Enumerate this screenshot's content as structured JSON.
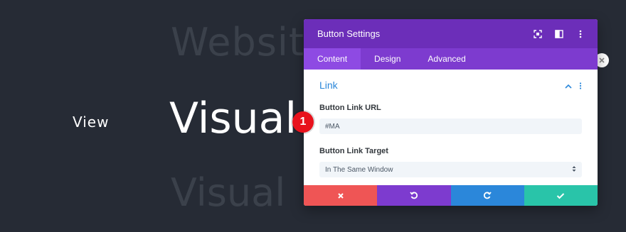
{
  "background": {
    "website_text": "Websit",
    "view_text": "View",
    "visual_text": "Visual",
    "visual2_text": "Visual"
  },
  "marker": {
    "number": "1"
  },
  "modal": {
    "title": "Button Settings",
    "tabs": [
      {
        "label": "Content",
        "active": true
      },
      {
        "label": "Design",
        "active": false
      },
      {
        "label": "Advanced",
        "active": false
      }
    ],
    "section": {
      "title": "Link",
      "fields": [
        {
          "label": "Button Link URL",
          "value": "#MA"
        },
        {
          "label": "Button Link Target",
          "value": "In The Same Window"
        }
      ]
    }
  },
  "colors": {
    "header": "#6c2eb9",
    "tabs": "#7d3bcf",
    "cancel": "#ef5555",
    "undo": "#7d3bcf",
    "redo": "#2b87da",
    "save": "#29c4a9",
    "accent": "#2b87da"
  },
  "icons": {
    "header": [
      "expand-icon",
      "split-icon",
      "more-vertical-icon"
    ],
    "section": [
      "chevron-up-icon",
      "more-vertical-icon"
    ],
    "footer": [
      "close-icon",
      "undo-icon",
      "redo-icon",
      "check-icon"
    ]
  }
}
